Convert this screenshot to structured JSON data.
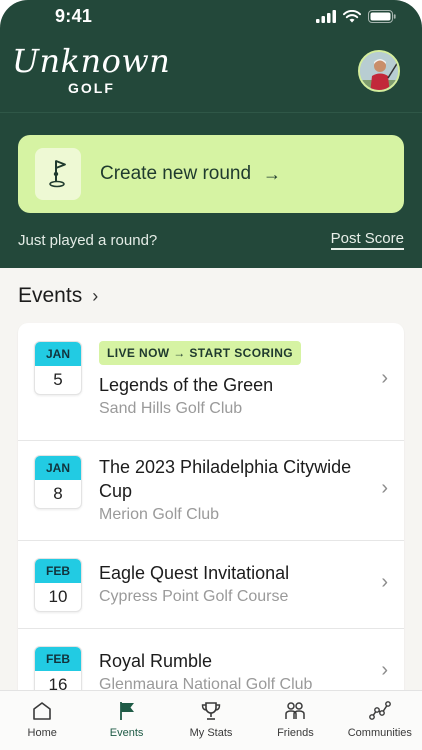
{
  "status_bar": {
    "time": "9:41"
  },
  "brand": {
    "script": "Unknown",
    "golf": "GOLF"
  },
  "create_round": {
    "label": "Create new round",
    "arrow": "→",
    "icon": "flag-pin-icon"
  },
  "played": {
    "prompt": "Just played a round?",
    "link": "Post Score"
  },
  "events_section": {
    "title": "Events",
    "chevron": "›"
  },
  "events": [
    {
      "month": "JAN",
      "day": "5",
      "badge": "LIVE NOW → START SCORING",
      "name": "Legends of the Green",
      "club": "Sand Hills Golf Club"
    },
    {
      "month": "JAN",
      "day": "8",
      "name": "The 2023 Philadelphia Citywide Cup",
      "club": "Merion Golf Club"
    },
    {
      "month": "FEB",
      "day": "10",
      "name": "Eagle Quest Invitational",
      "club": "Cypress Point Golf Course"
    },
    {
      "month": "FEB",
      "day": "16",
      "name": "Royal Rumble",
      "club": "Glenmaura National Golf Club"
    }
  ],
  "tabs": [
    {
      "label": "Home",
      "icon": "home-icon",
      "active": false
    },
    {
      "label": "Events",
      "icon": "flag-icon",
      "active": true
    },
    {
      "label": "My Stats",
      "icon": "trophy-icon",
      "active": false
    },
    {
      "label": "Friends",
      "icon": "people-icon",
      "active": false
    },
    {
      "label": "Communities",
      "icon": "network-icon",
      "active": false
    }
  ],
  "colors": {
    "header_bg": "#23483a",
    "lime": "#d6f3a3",
    "cyan": "#22cbe3",
    "active_tab": "#1f5b46"
  }
}
